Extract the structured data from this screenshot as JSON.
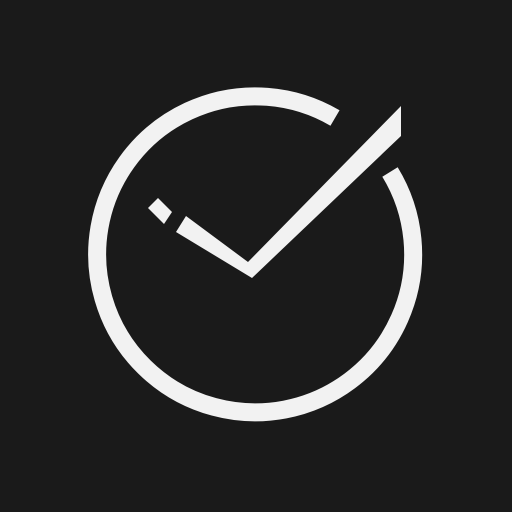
{
  "icon": {
    "name": "check-circle-icon"
  },
  "colors": {
    "background": "#1a1a1a",
    "foreground": "#f2f2f2"
  }
}
